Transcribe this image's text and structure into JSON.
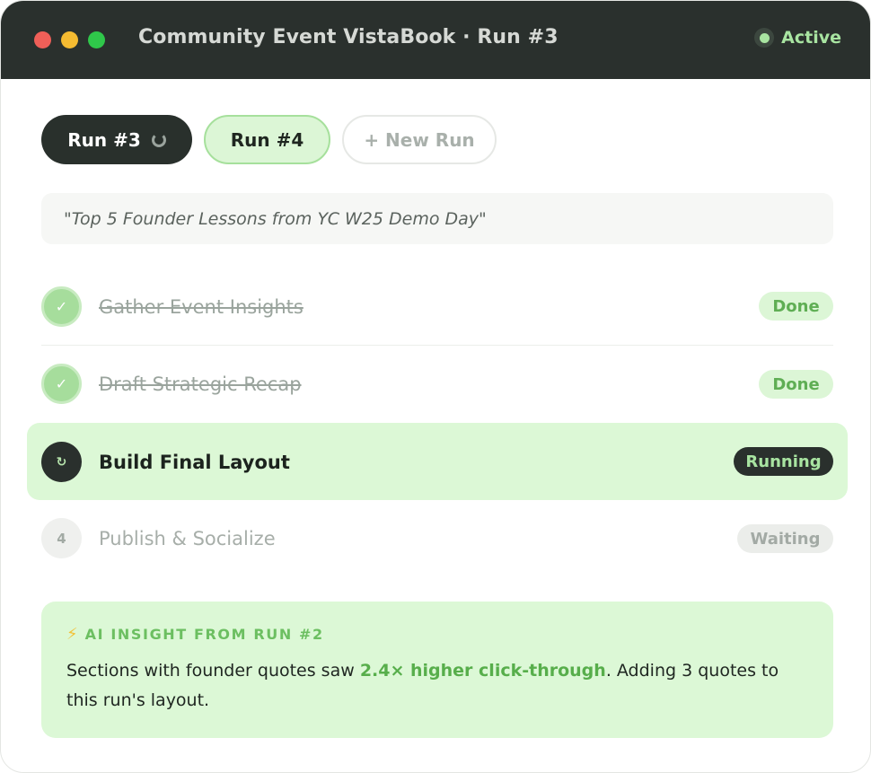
{
  "window": {
    "title": "Community Event VistaBook · Run #3",
    "status": "Active"
  },
  "tabs": {
    "current": "Run #3",
    "next": "Run #4",
    "new": "+ New Run"
  },
  "prompt": "\"Top 5 Founder Lessons from YC W25 Demo Day\"",
  "steps": [
    {
      "icon": "✓",
      "label": "Gather Event Insights",
      "badge": "Done",
      "state": "done"
    },
    {
      "icon": "✓",
      "label": "Draft Strategic Recap",
      "badge": "Done",
      "state": "done"
    },
    {
      "icon": "↻",
      "label": "Build Final Layout",
      "badge": "Running",
      "state": "running"
    },
    {
      "icon": "4",
      "label": "Publish & Socialize",
      "badge": "Waiting",
      "state": "waiting"
    }
  ],
  "insight": {
    "icon": "⚡",
    "heading": "AI INSIGHT FROM RUN #2",
    "text_before": "Sections with founder quotes saw ",
    "highlight": "2.4× higher click-through",
    "text_after": ". Adding 3 quotes to this run's layout."
  },
  "colors": {
    "titlebar": "#2a302d",
    "accent_green": "#a8e4a1",
    "highlight_green": "#57ae4b",
    "panel_green": "#dcf8d6"
  }
}
